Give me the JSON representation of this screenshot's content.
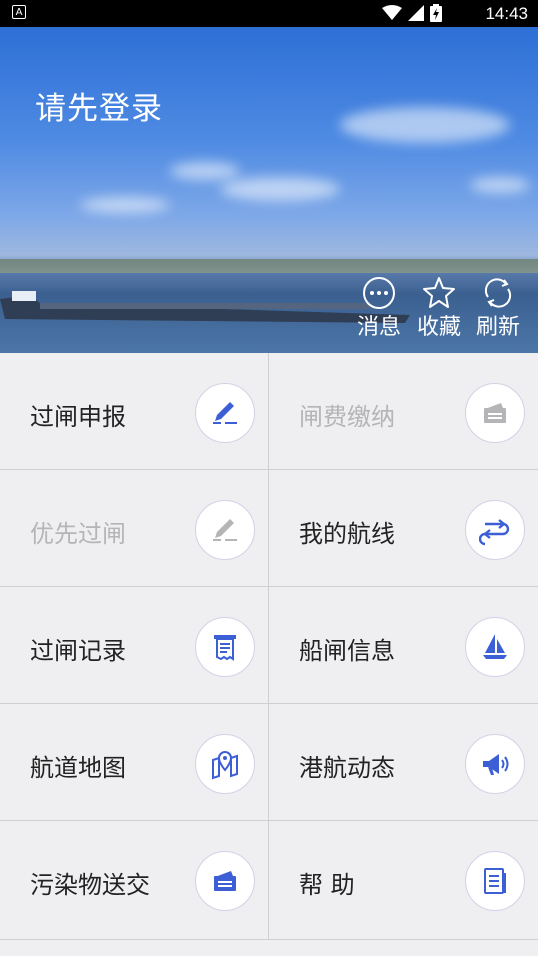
{
  "status_bar": {
    "time": "14:43",
    "notification_icon": "A"
  },
  "banner": {
    "login_prompt": "请先登录",
    "actions": [
      {
        "label": "消息",
        "icon": "message-icon"
      },
      {
        "label": "收藏",
        "icon": "star-icon"
      },
      {
        "label": "刷新",
        "icon": "refresh-icon"
      }
    ]
  },
  "menu": [
    {
      "label": "过闸申报",
      "icon": "edit-pen-icon",
      "enabled": true
    },
    {
      "label": "闸费缴纳",
      "icon": "payment-card-icon",
      "enabled": false
    },
    {
      "label": "优先过闸",
      "icon": "edit-pen-icon",
      "enabled": false
    },
    {
      "label": "我的航线",
      "icon": "route-arrows-icon",
      "enabled": true
    },
    {
      "label": "过闸记录",
      "icon": "receipt-icon",
      "enabled": true
    },
    {
      "label": "船闸信息",
      "icon": "sailboat-icon",
      "enabled": true
    },
    {
      "label": "航道地图",
      "icon": "map-pin-icon",
      "enabled": true
    },
    {
      "label": "港航动态",
      "icon": "megaphone-icon",
      "enabled": true
    },
    {
      "label": "污染物送交",
      "icon": "card-stack-icon",
      "enabled": true
    },
    {
      "label": "帮 助",
      "icon": "document-icon",
      "enabled": true
    }
  ],
  "colors": {
    "accent": "#3c5fd6",
    "disabled": "#b5b5b8"
  }
}
